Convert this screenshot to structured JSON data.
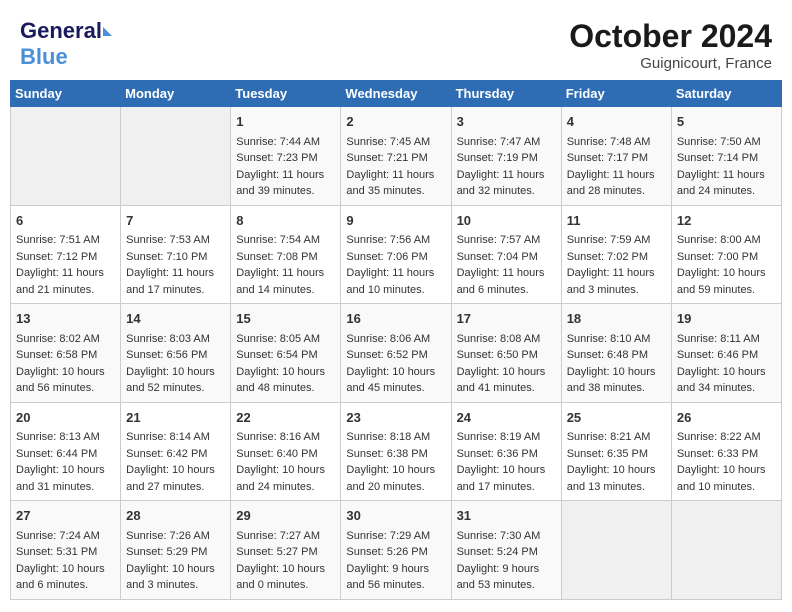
{
  "header": {
    "logo_line1": "General",
    "logo_line2": "Blue",
    "month_title": "October 2024",
    "subtitle": "Guignicourt, France"
  },
  "calendar": {
    "days_of_week": [
      "Sunday",
      "Monday",
      "Tuesday",
      "Wednesday",
      "Thursday",
      "Friday",
      "Saturday"
    ],
    "weeks": [
      [
        {
          "day": "",
          "sunrise": "",
          "sunset": "",
          "daylight": "",
          "empty": true
        },
        {
          "day": "",
          "sunrise": "",
          "sunset": "",
          "daylight": "",
          "empty": true
        },
        {
          "day": "1",
          "sunrise": "Sunrise: 7:44 AM",
          "sunset": "Sunset: 7:23 PM",
          "daylight": "Daylight: 11 hours and 39 minutes."
        },
        {
          "day": "2",
          "sunrise": "Sunrise: 7:45 AM",
          "sunset": "Sunset: 7:21 PM",
          "daylight": "Daylight: 11 hours and 35 minutes."
        },
        {
          "day": "3",
          "sunrise": "Sunrise: 7:47 AM",
          "sunset": "Sunset: 7:19 PM",
          "daylight": "Daylight: 11 hours and 32 minutes."
        },
        {
          "day": "4",
          "sunrise": "Sunrise: 7:48 AM",
          "sunset": "Sunset: 7:17 PM",
          "daylight": "Daylight: 11 hours and 28 minutes."
        },
        {
          "day": "5",
          "sunrise": "Sunrise: 7:50 AM",
          "sunset": "Sunset: 7:14 PM",
          "daylight": "Daylight: 11 hours and 24 minutes."
        }
      ],
      [
        {
          "day": "6",
          "sunrise": "Sunrise: 7:51 AM",
          "sunset": "Sunset: 7:12 PM",
          "daylight": "Daylight: 11 hours and 21 minutes."
        },
        {
          "day": "7",
          "sunrise": "Sunrise: 7:53 AM",
          "sunset": "Sunset: 7:10 PM",
          "daylight": "Daylight: 11 hours and 17 minutes."
        },
        {
          "day": "8",
          "sunrise": "Sunrise: 7:54 AM",
          "sunset": "Sunset: 7:08 PM",
          "daylight": "Daylight: 11 hours and 14 minutes."
        },
        {
          "day": "9",
          "sunrise": "Sunrise: 7:56 AM",
          "sunset": "Sunset: 7:06 PM",
          "daylight": "Daylight: 11 hours and 10 minutes."
        },
        {
          "day": "10",
          "sunrise": "Sunrise: 7:57 AM",
          "sunset": "Sunset: 7:04 PM",
          "daylight": "Daylight: 11 hours and 6 minutes."
        },
        {
          "day": "11",
          "sunrise": "Sunrise: 7:59 AM",
          "sunset": "Sunset: 7:02 PM",
          "daylight": "Daylight: 11 hours and 3 minutes."
        },
        {
          "day": "12",
          "sunrise": "Sunrise: 8:00 AM",
          "sunset": "Sunset: 7:00 PM",
          "daylight": "Daylight: 10 hours and 59 minutes."
        }
      ],
      [
        {
          "day": "13",
          "sunrise": "Sunrise: 8:02 AM",
          "sunset": "Sunset: 6:58 PM",
          "daylight": "Daylight: 10 hours and 56 minutes."
        },
        {
          "day": "14",
          "sunrise": "Sunrise: 8:03 AM",
          "sunset": "Sunset: 6:56 PM",
          "daylight": "Daylight: 10 hours and 52 minutes."
        },
        {
          "day": "15",
          "sunrise": "Sunrise: 8:05 AM",
          "sunset": "Sunset: 6:54 PM",
          "daylight": "Daylight: 10 hours and 48 minutes."
        },
        {
          "day": "16",
          "sunrise": "Sunrise: 8:06 AM",
          "sunset": "Sunset: 6:52 PM",
          "daylight": "Daylight: 10 hours and 45 minutes."
        },
        {
          "day": "17",
          "sunrise": "Sunrise: 8:08 AM",
          "sunset": "Sunset: 6:50 PM",
          "daylight": "Daylight: 10 hours and 41 minutes."
        },
        {
          "day": "18",
          "sunrise": "Sunrise: 8:10 AM",
          "sunset": "Sunset: 6:48 PM",
          "daylight": "Daylight: 10 hours and 38 minutes."
        },
        {
          "day": "19",
          "sunrise": "Sunrise: 8:11 AM",
          "sunset": "Sunset: 6:46 PM",
          "daylight": "Daylight: 10 hours and 34 minutes."
        }
      ],
      [
        {
          "day": "20",
          "sunrise": "Sunrise: 8:13 AM",
          "sunset": "Sunset: 6:44 PM",
          "daylight": "Daylight: 10 hours and 31 minutes."
        },
        {
          "day": "21",
          "sunrise": "Sunrise: 8:14 AM",
          "sunset": "Sunset: 6:42 PM",
          "daylight": "Daylight: 10 hours and 27 minutes."
        },
        {
          "day": "22",
          "sunrise": "Sunrise: 8:16 AM",
          "sunset": "Sunset: 6:40 PM",
          "daylight": "Daylight: 10 hours and 24 minutes."
        },
        {
          "day": "23",
          "sunrise": "Sunrise: 8:18 AM",
          "sunset": "Sunset: 6:38 PM",
          "daylight": "Daylight: 10 hours and 20 minutes."
        },
        {
          "day": "24",
          "sunrise": "Sunrise: 8:19 AM",
          "sunset": "Sunset: 6:36 PM",
          "daylight": "Daylight: 10 hours and 17 minutes."
        },
        {
          "day": "25",
          "sunrise": "Sunrise: 8:21 AM",
          "sunset": "Sunset: 6:35 PM",
          "daylight": "Daylight: 10 hours and 13 minutes."
        },
        {
          "day": "26",
          "sunrise": "Sunrise: 8:22 AM",
          "sunset": "Sunset: 6:33 PM",
          "daylight": "Daylight: 10 hours and 10 minutes."
        }
      ],
      [
        {
          "day": "27",
          "sunrise": "Sunrise: 7:24 AM",
          "sunset": "Sunset: 5:31 PM",
          "daylight": "Daylight: 10 hours and 6 minutes."
        },
        {
          "day": "28",
          "sunrise": "Sunrise: 7:26 AM",
          "sunset": "Sunset: 5:29 PM",
          "daylight": "Daylight: 10 hours and 3 minutes."
        },
        {
          "day": "29",
          "sunrise": "Sunrise: 7:27 AM",
          "sunset": "Sunset: 5:27 PM",
          "daylight": "Daylight: 10 hours and 0 minutes."
        },
        {
          "day": "30",
          "sunrise": "Sunrise: 7:29 AM",
          "sunset": "Sunset: 5:26 PM",
          "daylight": "Daylight: 9 hours and 56 minutes."
        },
        {
          "day": "31",
          "sunrise": "Sunrise: 7:30 AM",
          "sunset": "Sunset: 5:24 PM",
          "daylight": "Daylight: 9 hours and 53 minutes."
        },
        {
          "day": "",
          "sunrise": "",
          "sunset": "",
          "daylight": "",
          "empty": true
        },
        {
          "day": "",
          "sunrise": "",
          "sunset": "",
          "daylight": "",
          "empty": true
        }
      ]
    ]
  }
}
